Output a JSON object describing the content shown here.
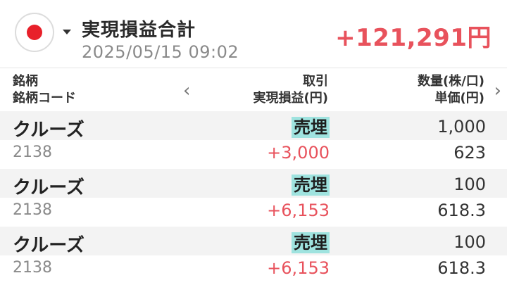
{
  "header": {
    "title": "実現損益合計",
    "datetime": "2025/05/15 09:02",
    "total": "+121,291円",
    "flag_icon": "japan-flag-icon",
    "accent_color": "#e8525c"
  },
  "columns": {
    "col1_line1": "銘柄",
    "col1_line2": "銘柄コード",
    "col2_line1": "取引",
    "col2_line2": "実現損益(円)",
    "col3_line1": "数量(株/口)",
    "col3_line2": "単価(円)",
    "prev_symbol": "‹",
    "next_symbol": "›"
  },
  "rows": [
    {
      "name": "クルーズ",
      "trade": "売埋",
      "quantity": "1,000",
      "code": "2138",
      "pl": "+3,000",
      "price": "623"
    },
    {
      "name": "クルーズ",
      "trade": "売埋",
      "quantity": "100",
      "code": "2138",
      "pl": "+6,153",
      "price": "618.3"
    },
    {
      "name": "クルーズ",
      "trade": "売埋",
      "quantity": "100",
      "code": "2138",
      "pl": "+6,153",
      "price": "618.3"
    }
  ]
}
